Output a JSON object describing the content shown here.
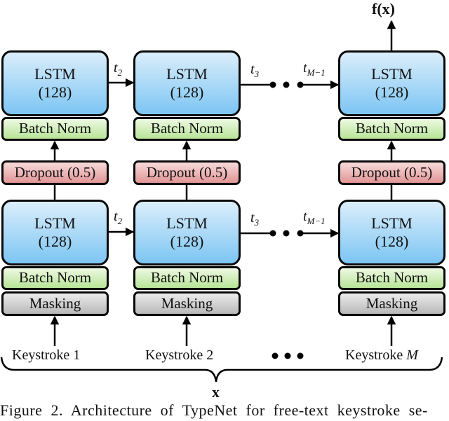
{
  "diagram": {
    "output_label": "f(x)",
    "input_label": "x",
    "columns": [
      {
        "upper": {
          "lstm_title": "LSTM",
          "lstm_units": "(128)",
          "batch_norm": "Batch Norm"
        },
        "dropout": "Dropout (0.5)",
        "lower": {
          "lstm_title": "LSTM",
          "lstm_units": "(128)",
          "batch_norm": "Batch Norm",
          "masking": "Masking"
        },
        "input": "Keystroke 1"
      },
      {
        "upper": {
          "lstm_title": "LSTM",
          "lstm_units": "(128)",
          "batch_norm": "Batch Norm"
        },
        "dropout": "Dropout (0.5)",
        "lower": {
          "lstm_title": "LSTM",
          "lstm_units": "(128)",
          "batch_norm": "Batch Norm",
          "masking": "Masking"
        },
        "input": "Keystroke 2"
      },
      {
        "upper": {
          "lstm_title": "LSTM",
          "lstm_units": "(128)",
          "batch_norm": "Batch Norm"
        },
        "dropout": "Dropout (0.5)",
        "lower": {
          "lstm_title": "LSTM",
          "lstm_units": "(128)",
          "batch_norm": "Batch Norm",
          "masking": "Masking"
        },
        "input": "Keystroke",
        "input_var": "M"
      }
    ],
    "time_labels": {
      "t2": {
        "base": "t",
        "sub": "2"
      },
      "t3": {
        "base": "t",
        "sub": "3"
      },
      "tM1": {
        "base": "t",
        "sub": "M−1"
      }
    },
    "ellipsis": "• • •",
    "colors": {
      "lstm": "#7cc5f3",
      "batch_norm": "#b7e497",
      "dropout": "#e29595",
      "masking": "#b8b8b8"
    }
  },
  "caption": "Figure 2. Architecture of TypeNet for free-text keystroke se-"
}
